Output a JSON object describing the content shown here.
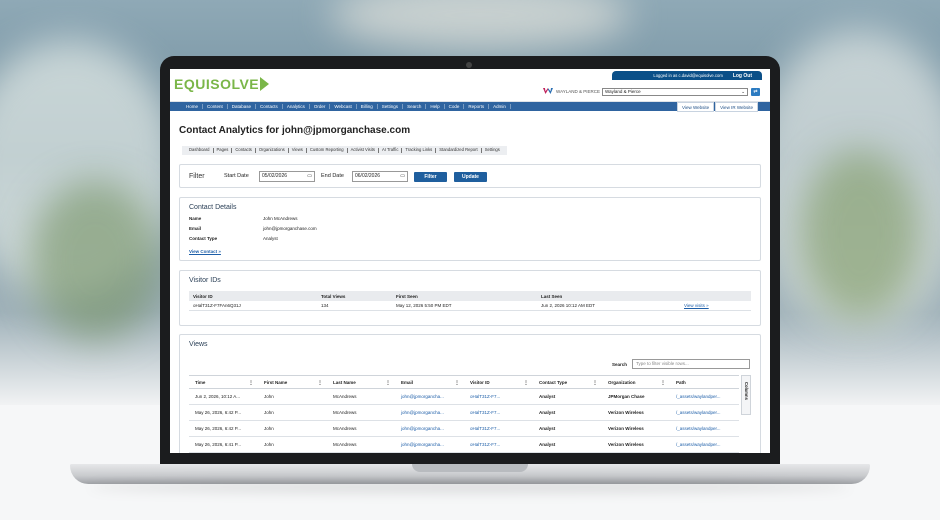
{
  "header": {
    "logo": "EQUISOLVE",
    "logged_in_text": "Logged in as c.david@equisolve.com",
    "logout": "Log Out",
    "client_brand": "WAYLAND & PIERCE",
    "client_select": "Wayland & Pierce",
    "go_icon": "refresh-arrow-icon"
  },
  "nav": {
    "items": [
      "Home",
      "Content",
      "Database",
      "Contacts",
      "Analytics",
      "Order",
      "Webcast",
      "Billing",
      "Settings",
      "Search",
      "Help",
      "Code",
      "Reports",
      "Admin"
    ],
    "view_website": "View Website",
    "view_ir_website": "View IR Website"
  },
  "page": {
    "title": "Contact Analytics for john@jpmorganchase.com",
    "subnav": [
      "Dashboard",
      "Pages",
      "Contacts",
      "Organizations",
      "Views",
      "Custom Reporting",
      "Activist Visits",
      "AI Traffic",
      "Tracking Links",
      "Standardized Report",
      "Settings"
    ]
  },
  "filter": {
    "title": "Filter",
    "start_label": "Start Date",
    "start_value": "05/02/2026",
    "end_label": "End Date",
    "end_value": "06/02/2026",
    "filter_button": "Filter",
    "update_button": "Update"
  },
  "contact": {
    "title": "Contact Details",
    "name_label": "Name",
    "name_value": "John McAndrews",
    "email_label": "Email",
    "email_value": "john@jpmorganchase.com",
    "type_label": "Contact Type",
    "type_value": "Analyst",
    "view_link": "View Contact »"
  },
  "visitors": {
    "title": "Visitor IDs",
    "headers": [
      "Visitor ID",
      "Total Views",
      "First Seen",
      "Last Seen",
      ""
    ],
    "rows": [
      [
        "oHalT31Z-F7FAn6Q31J",
        "134",
        "May 12, 2026 5:50 PM EDT",
        "Jun 2, 2026 10:12 AM EDT",
        "View visits »"
      ]
    ]
  },
  "views": {
    "title": "Views",
    "search_label": "Search",
    "search_placeholder": "Type to filter visible rows...",
    "columns_tab": "Columns",
    "headers": [
      "Time",
      "First Name",
      "Last Name",
      "Email",
      "Visitor ID",
      "Contact Type",
      "Organization",
      "Path"
    ],
    "rows": [
      [
        "Jun 2, 2026, 10:12 A...",
        "John",
        "McAndrews",
        "john@jpmorgancha...",
        "oHalT31Z-F7...",
        "Analyst",
        "JPMorgan Chase",
        "/_assets/waylandper..."
      ],
      [
        "May 26, 2026, 6:42 P...",
        "John",
        "McAndrews",
        "john@jpmorgancha...",
        "oHalT31Z-F7...",
        "Analyst",
        "Verizon Wireless",
        "/_assets/waylandper..."
      ],
      [
        "May 26, 2026, 6:42 P...",
        "John",
        "McAndrews",
        "john@jpmorgancha...",
        "oHalT31Z-F7...",
        "Analyst",
        "Verizon Wireless",
        "/_assets/waylandper..."
      ],
      [
        "May 26, 2026, 6:41 P...",
        "John",
        "McAndrews",
        "john@jpmorgancha...",
        "oHalT31Z-F7...",
        "Analyst",
        "Verizon Wireless",
        "/_assets/waylandper..."
      ]
    ]
  },
  "colors": {
    "brand_green": "#7ab648",
    "nav_blue": "#2f64a0",
    "button_blue": "#1f5f9e",
    "link_blue": "#1d5ea8"
  }
}
